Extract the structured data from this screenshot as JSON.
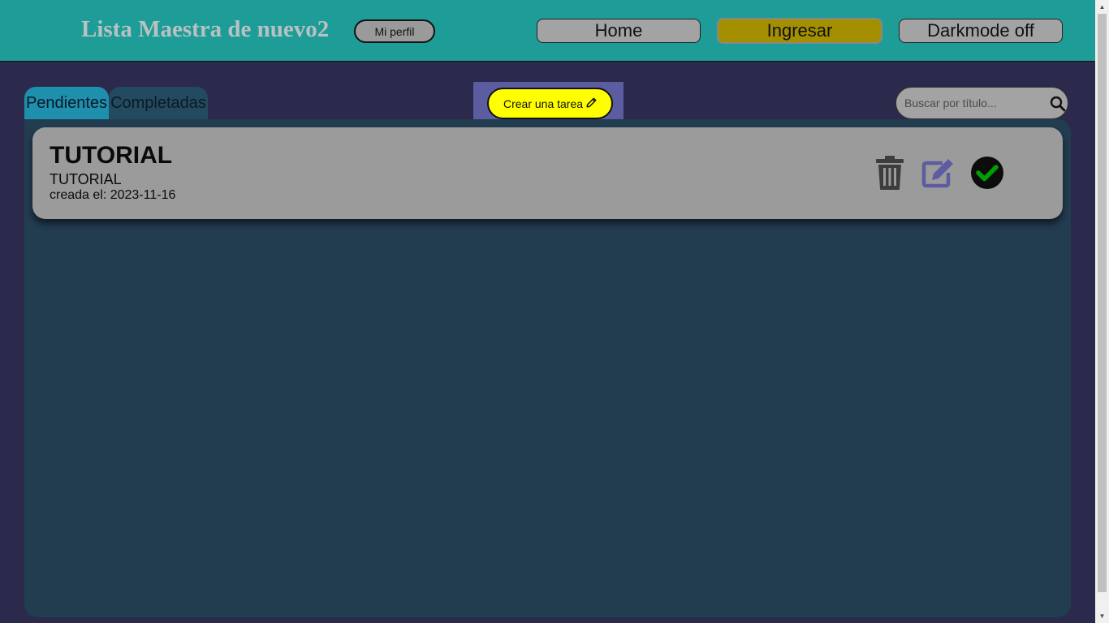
{
  "header": {
    "title": "Lista Maestra de nuevo2",
    "profile_label": "Mi perfil",
    "nav": {
      "home": "Home",
      "login": "Ingresar",
      "darkmode": "Darkmode off"
    }
  },
  "tabs": {
    "pending": "Pendientes",
    "completed": "Completadas"
  },
  "create_task": {
    "label": "Crear una tarea",
    "icon": "pencil-icon"
  },
  "search": {
    "placeholder": "Buscar por título...",
    "value": "",
    "icon": "search-icon"
  },
  "tasks": [
    {
      "title": "TUTORIAL",
      "description": "TUTORIAL",
      "created": "creada el: 2023-11-16",
      "actions": [
        "trash-icon",
        "edit-icon",
        "check-icon"
      ]
    }
  ],
  "colors": {
    "header_bg": "#1e9c97",
    "page_bg": "#2b2a4c",
    "panel_bg": "#223c50",
    "create_button": "#ffff00",
    "login_button": "#a38f00",
    "card_bg": "#9b9b9b",
    "edit_icon": "#5c5ca0",
    "check_icon": "#00a000"
  }
}
